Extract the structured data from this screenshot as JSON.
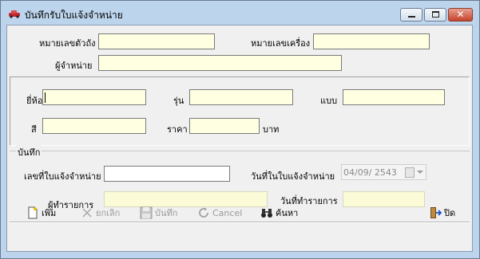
{
  "window": {
    "title": "บันทึกรับใบแจ้งจำหน่าย",
    "close_glyph": "✕"
  },
  "top": {
    "chassis_label": "หมายเลขตัวถัง",
    "engine_label": "หมายเลขเครื่อง",
    "dealer_label": "ผู้จำหน่าย",
    "chassis_value": "",
    "engine_value": "",
    "dealer_value": ""
  },
  "vehicle": {
    "brand_label": "ยี่ห้อ",
    "model_label": "รุ่น",
    "type_label": "แบบ",
    "color_label": "สี",
    "price_label": "ราคา",
    "currency_label": "บาท",
    "brand_value": "",
    "model_value": "",
    "type_value": "",
    "color_value": "",
    "price_value": ""
  },
  "record": {
    "group_title": "บันทึก",
    "notice_no_label": "เลขที่ใบแจ้งจำหน่าย",
    "notice_date_label": "วันที่ในใบแจ้งจำหน่าย",
    "notice_date_value": "04/09/ 2543",
    "operator_label": "ผู้ทำรายการ",
    "op_date_label": "วันที่ทำรายการ",
    "notice_no_value": "",
    "operator_value": "",
    "op_date_value": ""
  },
  "toolbar": {
    "add": "เพิ่ม",
    "cancel_th": "ยกเลิก",
    "save": "บันทึก",
    "cancel_en": "Cancel",
    "search": "ค้นหา",
    "close": "ปิด"
  }
}
